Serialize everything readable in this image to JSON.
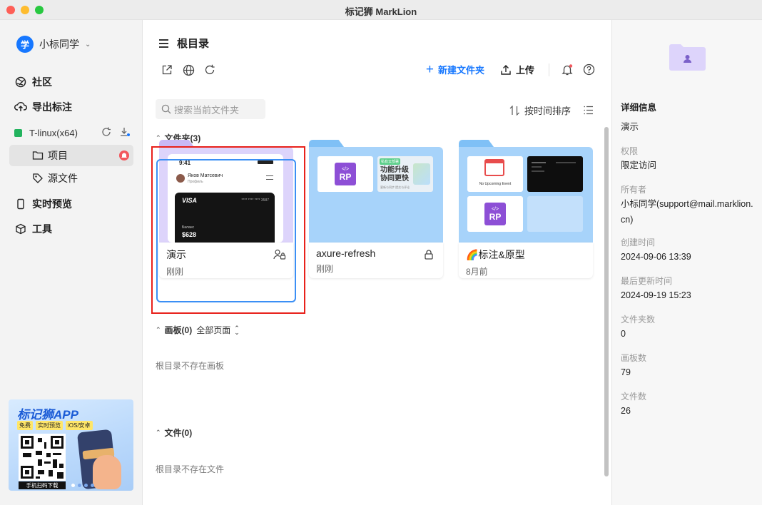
{
  "window": {
    "title": "标记狮 MarkLion"
  },
  "sidebar": {
    "user": {
      "avatar": "学",
      "name": "小标同学"
    },
    "nav": [
      {
        "label": "社区",
        "icon": "aperture-icon"
      },
      {
        "label": "导出标注",
        "icon": "cloud-upload-icon"
      }
    ],
    "project": {
      "name": "T-linux(x64)",
      "color": "#22b35e"
    },
    "sub_items": [
      {
        "label": "项目",
        "icon": "folder-icon",
        "active": true
      },
      {
        "label": "源文件",
        "icon": "tag-icon",
        "active": false
      }
    ],
    "nav2": [
      {
        "label": "实时预览",
        "icon": "phone-icon"
      },
      {
        "label": "工具",
        "icon": "cube-icon"
      }
    ],
    "promo": {
      "title": "标记狮APP",
      "tags": [
        "免费",
        "实时预览",
        "iOS/安卓"
      ],
      "qr_caption": "手机扫码下载"
    }
  },
  "main": {
    "breadcrumb": "根目录",
    "new_folder": "新建文件夹",
    "upload": "上传",
    "search_placeholder": "搜索当前文件夹",
    "sort_label": "按时间排序",
    "folders_header": "文件夹(3)",
    "boards_header": "画板(0)",
    "boards_filter": "全部页面",
    "boards_empty": "根目录不存在画板",
    "files_header": "文件(0)",
    "files_empty": "根目录不存在文件",
    "folders": [
      {
        "name": "演示",
        "time": "刚刚",
        "lock": "shared-user-lock-icon",
        "preview": {
          "clock": "9:41",
          "person": "Яков Матсевич",
          "sub": "Профиль",
          "card": "VISA",
          "card_no": "**** **** **** 3587",
          "balance": "Баланс",
          "amount": "$628"
        }
      },
      {
        "name": "axure-refresh",
        "time": "刚刚",
        "lock": "lock-icon",
        "preview": {
          "rp": "RP",
          "promo_badge": "私有云部署",
          "promo_line1": "功能升级",
          "promo_line2": "协同更快",
          "promo_foot": "更新与同步   提交与评论"
        }
      },
      {
        "name": "🌈标注&原型",
        "time": "8月前",
        "lock": "",
        "preview": {
          "event": "No Upcoming Event",
          "rp": "RP"
        }
      }
    ]
  },
  "details": {
    "title": "详细信息",
    "name": "演示",
    "fields": [
      {
        "key": "权限",
        "value": "限定访问"
      },
      {
        "key": "所有者",
        "value": "小标同学(support@mail.marklion.cn)"
      },
      {
        "key": "创建时间",
        "value": "2024-09-06 13:39"
      },
      {
        "key": "最后更新时间",
        "value": "2024-09-19 15:23"
      },
      {
        "key": "文件夹数",
        "value": "0"
      },
      {
        "key": "画板数",
        "value": "79"
      },
      {
        "key": "文件数",
        "value": "26"
      }
    ]
  },
  "colors": {
    "accent": "#1677ff",
    "folder_purple": "#ddd4fb",
    "folder_blue": "#a7d3fa",
    "selection_red": "#e8211b"
  }
}
